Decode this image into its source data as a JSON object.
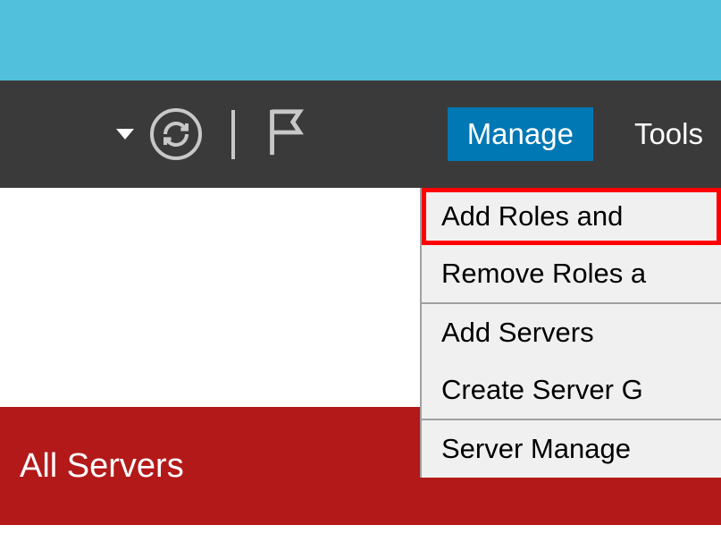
{
  "toolbar": {
    "menu": {
      "manage": "Manage",
      "tools": "Tools"
    }
  },
  "dropdown": {
    "items": [
      "Add Roles and",
      "Remove Roles a",
      "Add Servers",
      "Create Server G",
      "Server Manage"
    ]
  },
  "content": {
    "all_servers": "All Servers"
  }
}
